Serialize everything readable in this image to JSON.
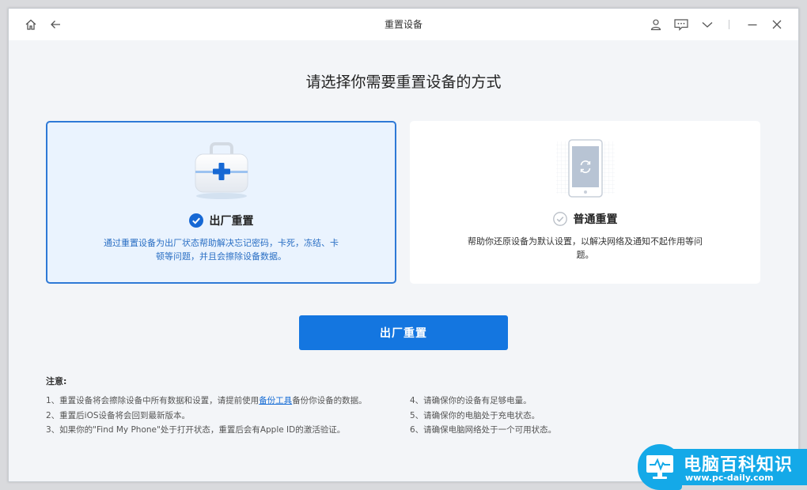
{
  "window": {
    "title": "重置设备",
    "icons": [
      "home-icon",
      "back-arrow-icon",
      "user-icon",
      "feedback-icon",
      "chevron-down-icon",
      "minimize-icon",
      "close-icon"
    ]
  },
  "main": {
    "heading": "请选择你需要重置设备的方式"
  },
  "options": [
    {
      "title": "出厂重置",
      "description": "通过重置设备为出厂状态帮助解决忘记密码，卡死，冻结、卡顿等问题，并且会擦除设备数据。",
      "selected": true,
      "icon": "medical-kit-icon"
    },
    {
      "title": "普通重置",
      "description": "帮助你还原设备为默认设置，以解决网络及通知不起作用等问题。",
      "selected": false,
      "icon": "phone-refresh-icon"
    }
  ],
  "action": {
    "button_label": "出厂重置"
  },
  "notes": {
    "title": "注意:",
    "item1_before": "1、重置设备将会擦除设备中所有数据和设置，请提前使用",
    "item1_link": "备份工具",
    "item1_after": "备份你设备的数据。",
    "item2": "2、重置后iOS设备将会回到最新版本。",
    "item3": "3、如果你的\"Find My Phone\"处于打开状态，重置后会有Apple ID的激活验证。",
    "item4": "4、请确保你的设备有足够电量。",
    "item5": "5、请确保你的电脑处于充电状态。",
    "item6": "6、请确保电脑网络处于一个可用状态。"
  },
  "watermark": {
    "text": "电脑百科知识",
    "url": "www.pc-daily.com"
  },
  "colors": {
    "accent": "#1476e0",
    "selected_border": "#2e79d6",
    "selected_bg": "#eaf3fe",
    "watermark_blue": "#14a9e8"
  }
}
